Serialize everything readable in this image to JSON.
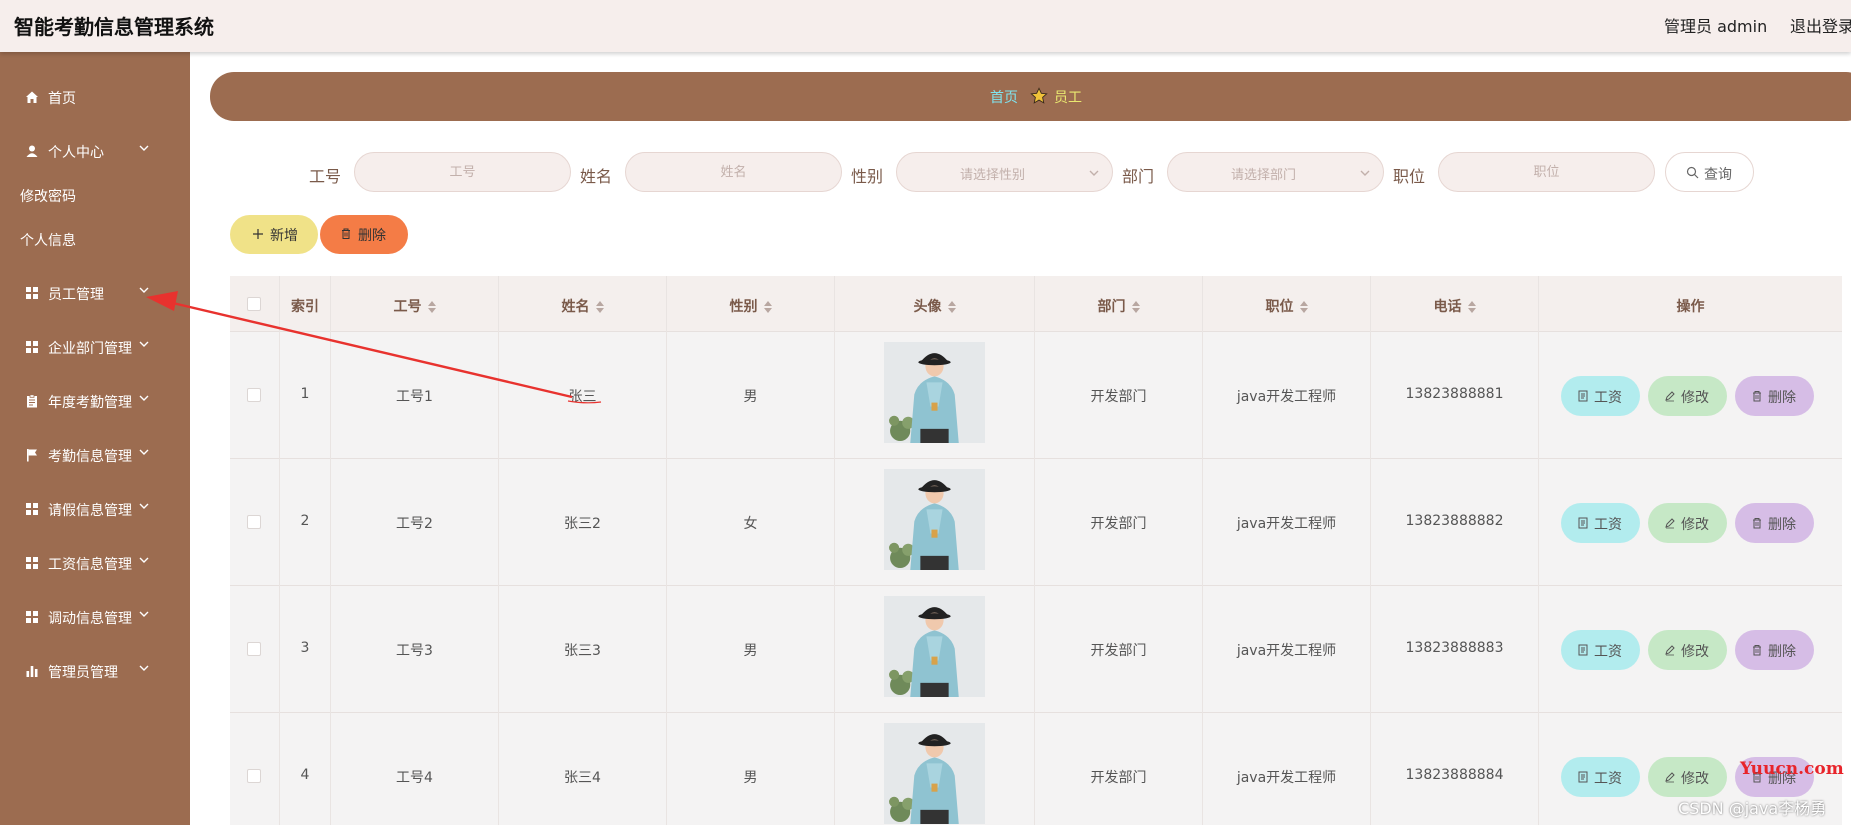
{
  "header": {
    "title": "智能考勤信息管理系统",
    "user": "管理员 admin",
    "logout": "退出登录"
  },
  "sidebar": {
    "items": [
      {
        "label": "首页",
        "icon": "home-icon"
      },
      {
        "label": "个人中心",
        "icon": "user-icon"
      },
      {
        "label": "员工管理",
        "icon": "grid-icon"
      },
      {
        "label": "企业部门管理",
        "icon": "grid-icon"
      },
      {
        "label": "年度考勤管理",
        "icon": "clipboard-icon"
      },
      {
        "label": "考勤信息管理",
        "icon": "flag-icon"
      },
      {
        "label": "请假信息管理",
        "icon": "grid-icon"
      },
      {
        "label": "工资信息管理",
        "icon": "grid-icon"
      },
      {
        "label": "调动信息管理",
        "icon": "grid-icon"
      },
      {
        "label": "管理员管理",
        "icon": "bar-chart-icon"
      }
    ],
    "sub": [
      "修改密码",
      "个人信息"
    ]
  },
  "breadcrumb": {
    "home": "首页",
    "current": "员工"
  },
  "search": {
    "gonghao_label": "工号",
    "gonghao_ph": "工号",
    "name_label": "姓名",
    "name_ph": "姓名",
    "gender_label": "性别",
    "gender_ph": "请选择性别",
    "dept_label": "部门",
    "dept_ph": "请选择部门",
    "position_label": "职位",
    "position_ph": "职位",
    "query": "查询"
  },
  "toolbar": {
    "add": "新增",
    "delete": "删除"
  },
  "table": {
    "headers": [
      "索引",
      "工号",
      "姓名",
      "性别",
      "头像",
      "部门",
      "职位",
      "电话",
      "操作"
    ],
    "rows": [
      {
        "index": "1",
        "gonghao": "工号1",
        "name": "张三",
        "gender": "男",
        "dept": "开发部门",
        "position": "java开发工程师",
        "phone": "13823888881"
      },
      {
        "index": "2",
        "gonghao": "工号2",
        "name": "张三2",
        "gender": "女",
        "dept": "开发部门",
        "position": "java开发工程师",
        "phone": "13823888882"
      },
      {
        "index": "3",
        "gonghao": "工号3",
        "name": "张三3",
        "gender": "男",
        "dept": "开发部门",
        "position": "java开发工程师",
        "phone": "13823888883"
      },
      {
        "index": "4",
        "gonghao": "工号4",
        "name": "张三4",
        "gender": "男",
        "dept": "开发部门",
        "position": "java开发工程师",
        "phone": "13823888884"
      }
    ],
    "actions": {
      "salary": "工资",
      "edit": "修改",
      "delete": "删除"
    }
  },
  "watermarks": {
    "yuucn": "Yuucn.com",
    "csdn": "CSDN @java李杨勇"
  },
  "colors": {
    "brand": "#9c6c50",
    "header_bg": "#f6eeec",
    "crumb_home": "#7fe3ee",
    "crumb_current": "#e9e870",
    "add_btn": "#f0e288",
    "delete_btn": "#f47c46",
    "salary_btn": "#b2ecee",
    "edit_btn": "#c6e8c6",
    "row_delete_btn": "#d6bde6",
    "annotation_arrow": "#e8322e"
  }
}
